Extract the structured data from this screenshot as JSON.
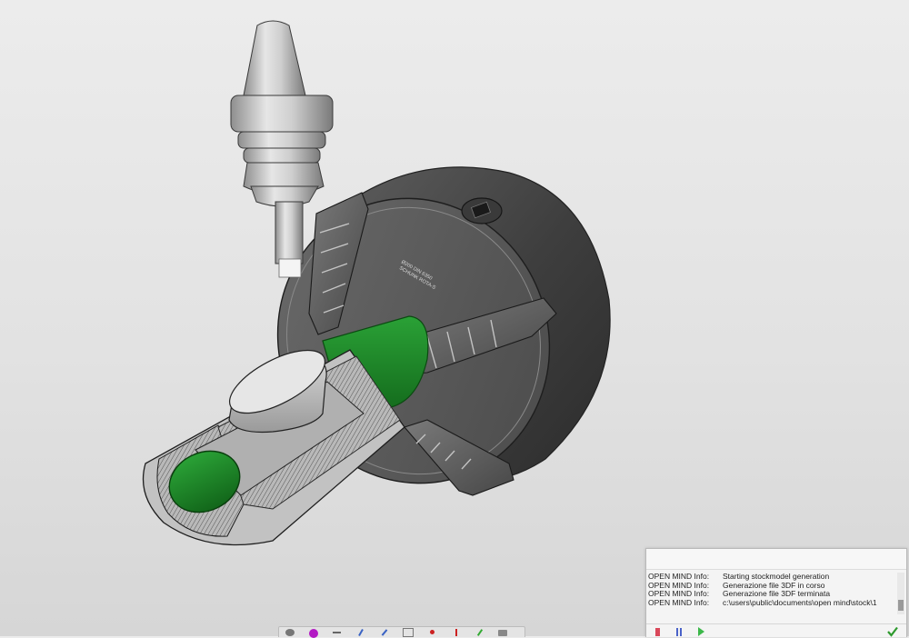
{
  "log_panel": {
    "messages": [
      {
        "source": "OPEN MIND Info:",
        "text": "Starting stockmodel generation"
      },
      {
        "source": "OPEN MIND Info:",
        "text": "Generazione file 3DF in corso"
      },
      {
        "source": "OPEN MIND Info:",
        "text": "Generazione file 3DF terminata"
      },
      {
        "source": "OPEN MIND Info:",
        "text": "c:\\users\\public\\documents\\open mind\\stock\\1"
      }
    ],
    "toolbar_icons": [
      "stop-icon",
      "pause-icon",
      "play-icon",
      "checkmark-icon"
    ],
    "colors": {
      "stop": "#d9485a",
      "pause": "#4a62c8",
      "play": "#3cb84a",
      "check": "#2e9a2e"
    }
  },
  "viewport": {
    "chuck_engraving": [
      "Ø200 DIN 6350",
      "SCHUNK ROTA-S"
    ],
    "colors": {
      "stock": "#1f8a2a",
      "chuck": "#4a4a4a",
      "tool_holder": "#c9c9c9"
    }
  },
  "bottom_toolbar": {
    "icons": [
      "view-icon",
      "shading-icon",
      "axis-icon",
      "measure-icon",
      "check-icon",
      "grid-icon",
      "marker-icon",
      "pin-icon",
      "pen-icon",
      "camera-icon"
    ]
  }
}
